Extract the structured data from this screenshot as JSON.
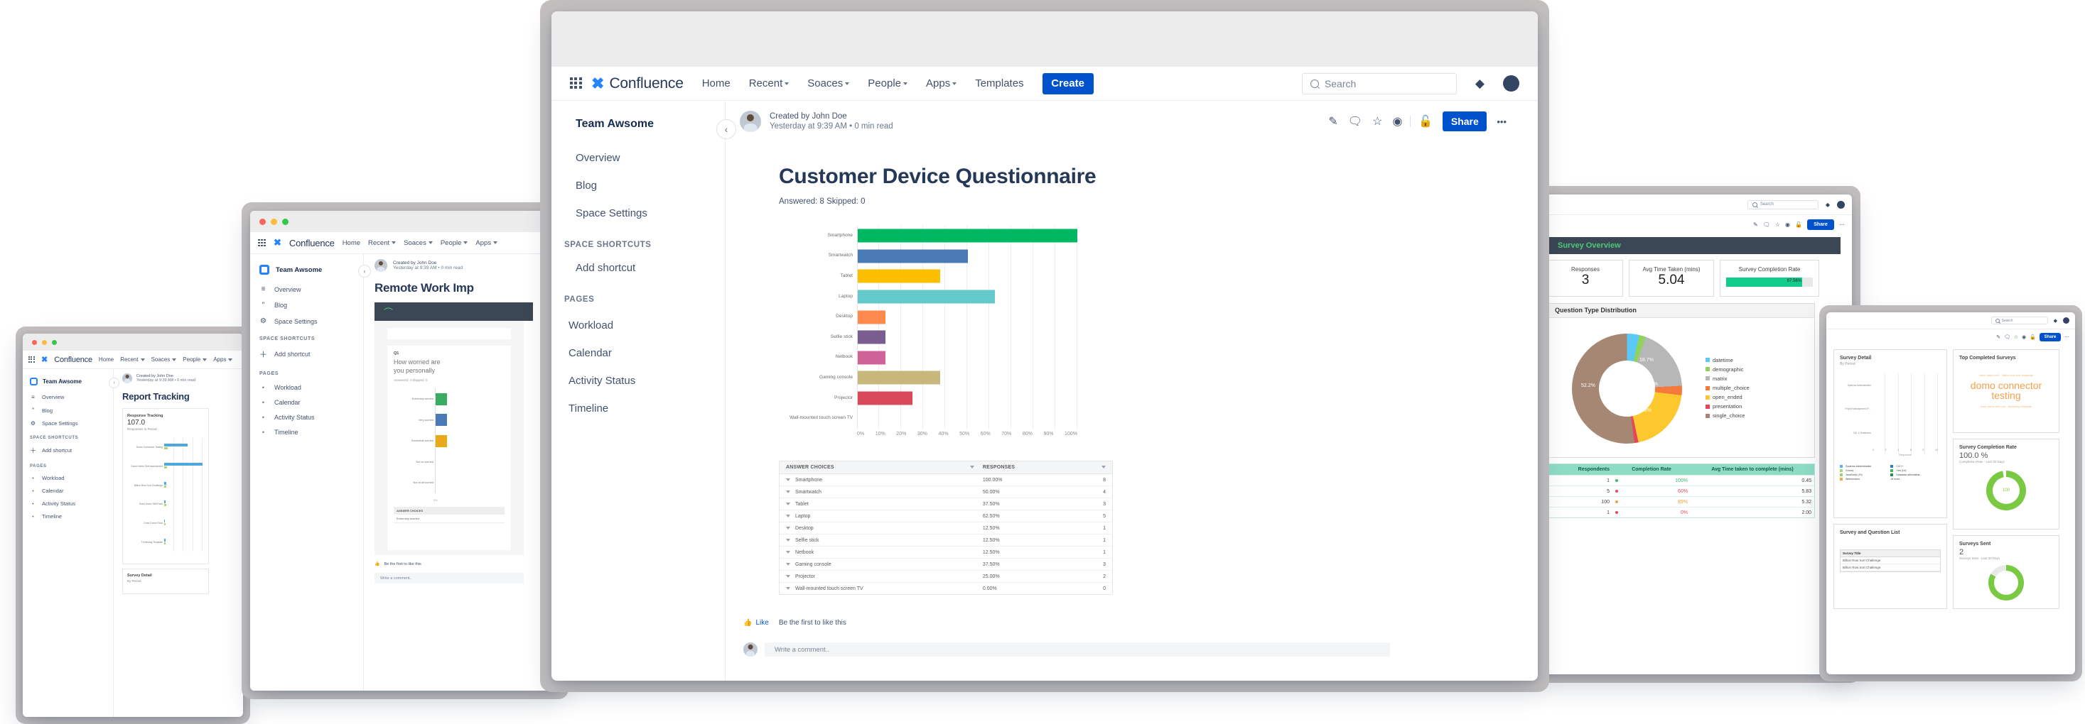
{
  "app": {
    "name": "Confluence",
    "nav_items": [
      {
        "label": "Home",
        "has_caret": false
      },
      {
        "label": "Recent",
        "has_caret": true
      },
      {
        "label": "Soaces",
        "has_caret": true
      },
      {
        "label": "People",
        "has_caret": true
      },
      {
        "label": "Apps",
        "has_caret": true
      },
      {
        "label": "Templates",
        "has_caret": false
      }
    ],
    "create_label": "Create",
    "search_placeholder": "Search",
    "accent_color": "#0052cc"
  },
  "sidebar": {
    "space_name": "Team Awsome",
    "primary": [
      {
        "label": "Overview",
        "icon": "overview-icon"
      },
      {
        "label": "Blog",
        "icon": "quote-icon"
      },
      {
        "label": "Space Settings",
        "icon": "gear-icon"
      }
    ],
    "shortcuts_heading": "SPACE SHORTCUTS",
    "add_shortcut_label": "Add shortcut",
    "pages_heading": "PAGES",
    "pages": [
      {
        "label": "Workload"
      },
      {
        "label": "Calendar"
      },
      {
        "label": "Activity Status"
      },
      {
        "label": "Timeline"
      }
    ]
  },
  "page": {
    "byline_author": "Created by John Doe",
    "byline_meta": "Yesterday at 9:39 AM  •  0 min read",
    "title": "Customer Device Questionnaire",
    "subtitle": "Answered: 8   Skipped: 0",
    "share_label": "Share",
    "more_label": "•••",
    "actions": [
      {
        "name": "edit-icon",
        "glyph": "✎"
      },
      {
        "name": "comment-icon",
        "glyph": "🗨"
      },
      {
        "name": "star-icon",
        "glyph": "☆"
      },
      {
        "name": "watch-icon",
        "glyph": "◉"
      },
      {
        "name": "restrictions-lock-icon",
        "glyph": "🔓"
      }
    ]
  },
  "footer": {
    "like_label": "Like",
    "like_hint": "Be the first to like this",
    "comment_placeholder": "Write a comment.."
  },
  "chart_data": {
    "type": "bar",
    "orientation": "horizontal",
    "title": "Customer Device Questionnaire",
    "xlabel": "",
    "ylabel": "",
    "xlim": [
      0,
      100
    ],
    "xticks": [
      "0%",
      "10%",
      "20%",
      "30%",
      "40%",
      "50%",
      "60%",
      "70%",
      "80%",
      "90%",
      "100%"
    ],
    "grid": true,
    "categories": [
      "Smartphone",
      "Smartwatch",
      "Tablet",
      "Laptop",
      "Desktop",
      "Selfie stick",
      "Netbook",
      "Gaming console",
      "Projector",
      "Wall-mounted touch screen TV"
    ],
    "values": [
      100.0,
      50.0,
      37.5,
      62.5,
      12.5,
      12.5,
      12.5,
      37.5,
      25.0,
      0.0
    ],
    "counts": [
      8,
      4,
      3,
      5,
      1,
      1,
      1,
      3,
      2,
      0
    ],
    "colors": [
      "#00b862",
      "#4a7ab5",
      "#fcbf00",
      "#63c9cb",
      "#ff8a4f",
      "#7a5c8e",
      "#d0629a",
      "#c8b77a",
      "#d9495b",
      "#cccccc"
    ]
  },
  "table": {
    "headers": [
      "ANSWER CHOICES",
      "RESPONSES",
      ""
    ],
    "rows": [
      {
        "choice": "Smartphone",
        "pct": "100.00%",
        "count": "8"
      },
      {
        "choice": "Smartwatch",
        "pct": "50.00%",
        "count": "4"
      },
      {
        "choice": "Tablet",
        "pct": "37.50%",
        "count": "3"
      },
      {
        "choice": "Laptop",
        "pct": "62.50%",
        "count": "5"
      },
      {
        "choice": "Desktop",
        "pct": "12.50%",
        "count": "1"
      },
      {
        "choice": "Selfie stick",
        "pct": "12.50%",
        "count": "1"
      },
      {
        "choice": "Netbook",
        "pct": "12.50%",
        "count": "1"
      },
      {
        "choice": "Gaming console",
        "pct": "37.50%",
        "count": "3"
      },
      {
        "choice": "Projector",
        "pct": "25.00%",
        "count": "2"
      },
      {
        "choice": "Wall-mounted touch screen TV",
        "pct": "0.00%",
        "count": "0"
      }
    ]
  },
  "window_report": {
    "title": "Report Tracking",
    "byline_author": "Created by John Doe",
    "byline_meta": "Yesterday at 9:39 AM  •  0 min read",
    "card_title": "Response Tracking",
    "card_value": "107.0",
    "card_caption": "Responses in Period",
    "axis_label": "Survey",
    "bars": [
      {
        "label": "Domo Connector Testing",
        "blue": 62,
        "green": 9
      },
      {
        "label": "Domo Intern Self Assessment",
        "blue": 100,
        "green": 7
      },
      {
        "label": "Billion Row Sort Challenge",
        "blue": 5,
        "green": 6
      },
      {
        "label": "Does Domo Still Rock",
        "blue": 3,
        "green": 5
      },
      {
        "label": "Does Domo Rock",
        "blue": 2,
        "green": 4
      },
      {
        "label": "TriViewing Template",
        "blue": 4,
        "green": 3
      }
    ],
    "second_card_title": "Survey Detail",
    "second_card_caption": "By Period"
  },
  "window_remote": {
    "title": "Remote Work Imp",
    "byline_author": "Created by John Doe",
    "byline_meta": "Yesterday at 9:39 AM  •  0 min read",
    "question_number": "Q1",
    "question_text_line1": "How worried are",
    "question_text_line2": "you personally",
    "question_meta": "Answered: 4   Skipped: 0",
    "choices": [
      {
        "label": "Extremely worried",
        "color": "#3aab62",
        "value": 30
      },
      {
        "label": "Very worried",
        "color": "#4a7ab5",
        "value": 30
      },
      {
        "label": "Somewhat worried",
        "color": "#e8aa18",
        "value": 30
      },
      {
        "label": "Not so worried",
        "color": "#ffffff",
        "value": 0
      },
      {
        "label": "Not at all worried",
        "color": "#ffffff",
        "value": 0
      }
    ],
    "axis_start": "0%",
    "table_header": "ANSWER CHOICES",
    "table_first_row": "Extremely worried",
    "like_label": "Be the first to like this",
    "comment_placeholder": "Write a comment.."
  },
  "window_dashboard": {
    "header": "Survey Overview",
    "search_placeholder": "Search",
    "share_label": "Share",
    "kpis": [
      {
        "caption": "Responses",
        "value": "3"
      },
      {
        "caption": "Avg Time Taken (mins)",
        "value": "5.04"
      }
    ],
    "completion_card": {
      "caption": "Survey Completion Rate",
      "value": "87.56%",
      "fill_pct": 87.56,
      "color": "#12cc8b"
    },
    "donut": {
      "title": "Question Type Distribution",
      "type": "pie",
      "labels": [
        "datetime",
        "demographic",
        "matrix",
        "multiple_choice",
        "open_ended",
        "presentation",
        "single_choice"
      ],
      "values": [
        3.5,
        2.0,
        18.7,
        2.7,
        19.8,
        1.1,
        52.2
      ],
      "colors": [
        "#5bc8f5",
        "#8ed45c",
        "#b7b7b7",
        "#f5783c",
        "#fdc72e",
        "#e8455c",
        "#a68774"
      ],
      "visible_labels": [
        "18.7%",
        "2.7%",
        "19.8%",
        "52.2%"
      ]
    },
    "table": {
      "headers": [
        "Respondents",
        "Completion Rate",
        "Avg Time taken to complete (mins)"
      ],
      "rows": [
        {
          "respondents": "1",
          "rate": "100%",
          "rate_color": "#3dbb74",
          "time": "0.45"
        },
        {
          "respondents": "5",
          "rate": "60%",
          "rate_color": "#e8495c",
          "time": "5.83"
        },
        {
          "respondents": "100",
          "rate": "89%",
          "rate_color": "#eaa33a",
          "time": "5.32"
        },
        {
          "respondents": "1",
          "rate": "0%",
          "rate_color": "#e8495c",
          "time": "2.00"
        }
      ]
    }
  },
  "window_cards": {
    "search_placeholder": "Search",
    "share_label": "Share",
    "detail_card": {
      "title": "Survey Detail",
      "caption": "By Period",
      "xlabel": "Responses",
      "xticks": [
        "0",
        "2",
        "4",
        "6",
        "8",
        "10"
      ]
    },
    "detail_legend": [
      {
        "label": "Systems Administration",
        "color": "#5bb4e8"
      },
      {
        "label": "C/C++",
        "color": "#2a7fc1"
      },
      {
        "label": "Groovy",
        "color": "#a8dd6a"
      },
      {
        "label": ".Net (C#)",
        "color": "#3dbb5a"
      },
      {
        "label": "JavaScript (JS)",
        "color": "#9ad06b"
      },
      {
        "label": "Database administrat...",
        "color": "#2e8b57"
      },
      {
        "label": "Webservices",
        "color": "#f0a93a"
      },
      {
        "label": "15 more...",
        "color": "transparent"
      }
    ],
    "cloud_card": {
      "title": "Top Completed Surveys",
      "main_word_line1": "domo connector",
      "main_word_line2": "testing"
    },
    "completion_card": {
      "title": "Survey Completion Rate",
      "value": "100.0 %",
      "caption": "Completion Rate - Last 30 Days",
      "gauge_label": "100"
    },
    "list_card": {
      "title": "Survey and Question List",
      "col1": "Survey Title",
      "rows": [
        "Billion Row Sort Challenge",
        "Billion Row Sort Challenge"
      ]
    },
    "sent_card": {
      "title": "Surveys Sent",
      "value": "2",
      "caption": "Surveys Sent - Last 30 Days"
    }
  }
}
